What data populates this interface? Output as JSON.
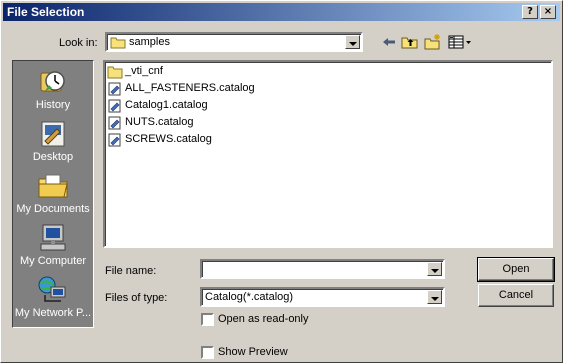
{
  "window": {
    "title": "File Selection",
    "help_label": "?",
    "close_label": "×"
  },
  "toolbar": {
    "look_in_label": "Look in:",
    "look_in_value": "samples"
  },
  "places": [
    {
      "label": "History",
      "icon": "history-icon"
    },
    {
      "label": "Desktop",
      "icon": "desktop-icon"
    },
    {
      "label": "My Documents",
      "icon": "my-documents-icon"
    },
    {
      "label": "My Computer",
      "icon": "my-computer-icon"
    },
    {
      "label": "My Network P...",
      "icon": "my-network-places-icon"
    }
  ],
  "files": [
    {
      "name": "_vti_cnf",
      "type": "folder"
    },
    {
      "name": "ALL_FASTENERS.catalog",
      "type": "catalog"
    },
    {
      "name": "Catalog1.catalog",
      "type": "catalog"
    },
    {
      "name": "NUTS.catalog",
      "type": "catalog"
    },
    {
      "name": "SCREWS.catalog",
      "type": "catalog"
    }
  ],
  "form": {
    "file_name_label": "File name:",
    "file_name_value": "",
    "file_type_label": "Files of type:",
    "file_type_value": "Catalog(*.catalog)",
    "read_only_label": "Open as read-only",
    "show_preview_label": "Show Preview"
  },
  "buttons": {
    "open": "Open",
    "cancel": "Cancel"
  }
}
